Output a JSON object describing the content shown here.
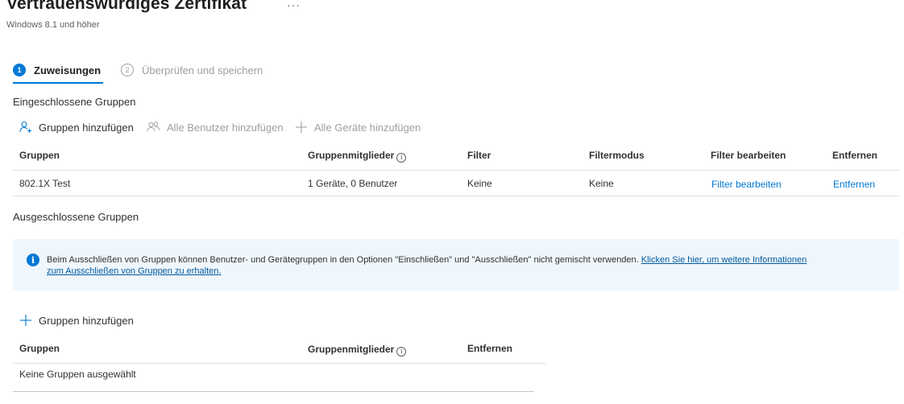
{
  "header": {
    "title": "Vertrauenswürdiges Zertifikat",
    "more_label": "···",
    "subtitle": "Windows 8.1 und höher"
  },
  "steps": [
    {
      "number": "1",
      "label": "Zuweisungen",
      "active": true
    },
    {
      "number": "2",
      "label": "Überprüfen und speichern",
      "active": false
    }
  ],
  "included": {
    "title": "Eingeschlossene Gruppen",
    "commands": {
      "add_groups": "Gruppen hinzufügen",
      "add_all_users": "Alle Benutzer hinzufügen",
      "add_all_devices": "Alle Geräte hinzufügen"
    },
    "columns": {
      "groups": "Gruppen",
      "members": "Gruppenmitglieder",
      "filter": "Filter",
      "filter_mode": "Filtermodus",
      "edit_filter": "Filter bearbeiten",
      "remove": "Entfernen"
    },
    "rows": [
      {
        "group": "802.1X Test",
        "members": "1 Geräte, 0 Benutzer",
        "filter": "Keine",
        "filter_mode": "Keine",
        "edit_filter": "Filter bearbeiten",
        "remove": "Entfernen"
      }
    ]
  },
  "excluded": {
    "title": "Ausgeschlossene Gruppen",
    "info_text": "Beim Ausschließen von Gruppen können Benutzer- und Gerätegruppen in den Optionen \"Einschließen\" und \"Ausschließen\" nicht gemischt verwenden.",
    "info_link_line1": "Klicken Sie hier, um weitere Informationen",
    "info_link_line2": "zum Ausschließen von Gruppen zu erhalten.",
    "add_groups": "Gruppen hinzufügen",
    "columns": {
      "groups": "Gruppen",
      "members": "Gruppenmitglieder",
      "remove": "Entfernen"
    },
    "empty_text": "Keine Gruppen ausgewählt"
  },
  "colors": {
    "accent": "#0078d4",
    "disabled": "#a19f9d",
    "banner_bg": "#eff6fc"
  }
}
